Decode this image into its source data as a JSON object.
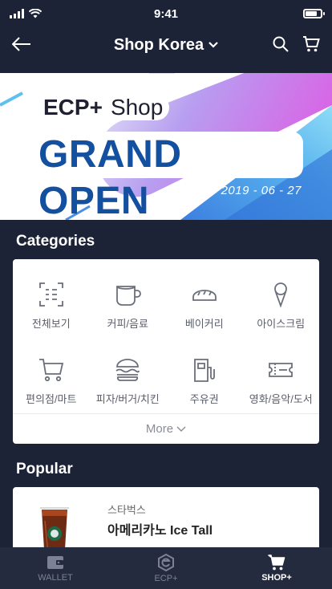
{
  "status_bar": {
    "time": "9:41"
  },
  "nav": {
    "title": "Shop Korea"
  },
  "banner": {
    "brand": "ECP+",
    "brand_suffix": "Shop",
    "headline": "GRAND OPEN",
    "date": "2019 - 06 - 27"
  },
  "categories": {
    "title": "Categories",
    "items": [
      {
        "label": "전체보기",
        "icon": "all-view-icon"
      },
      {
        "label": "커피/음료",
        "icon": "coffee-cup-icon"
      },
      {
        "label": "베이커리",
        "icon": "bread-icon"
      },
      {
        "label": "아이스크림",
        "icon": "ice-cream-icon"
      },
      {
        "label": "편의점/마트",
        "icon": "shopping-cart-icon"
      },
      {
        "label": "피자/버거/치킨",
        "icon": "burger-icon"
      },
      {
        "label": "주유권",
        "icon": "gas-pump-icon"
      },
      {
        "label": "영화/음악/도서",
        "icon": "ticket-icon"
      }
    ],
    "more_label": "More"
  },
  "popular": {
    "title": "Popular",
    "item": {
      "brand": "스타벅스",
      "name": "아메리카노 Ice Tall"
    }
  },
  "tabs": [
    {
      "label": "WALLET",
      "icon": "wallet-icon",
      "active": false
    },
    {
      "label": "ECP+",
      "icon": "ecp-logo-icon",
      "active": false
    },
    {
      "label": "SHOP+",
      "icon": "cart-icon",
      "active": true
    }
  ],
  "colors": {
    "background": "#1d2336",
    "tab_bar": "#252b3f",
    "headline": "#1450a0",
    "accent_purple": "#c76be8",
    "accent_blue": "#3f8fe6"
  }
}
